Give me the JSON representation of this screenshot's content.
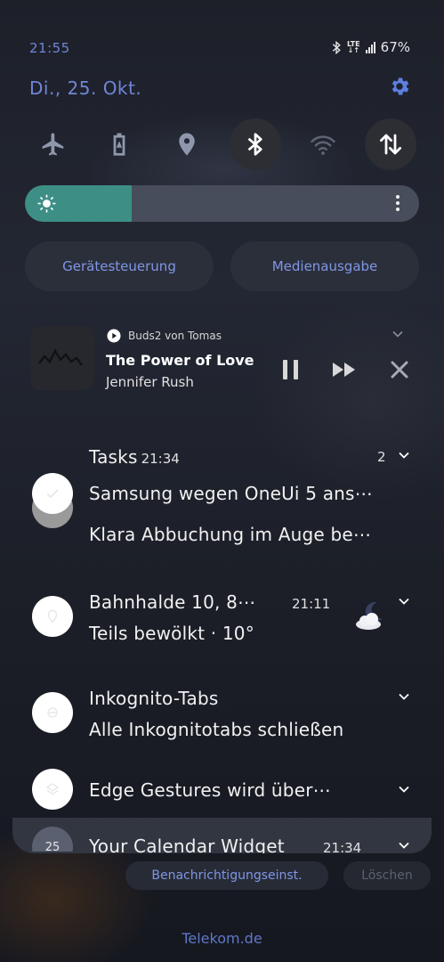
{
  "status_bar": {
    "time": "21:55",
    "network_type": "LTE",
    "battery": "67%",
    "icons": [
      "bluetooth-icon",
      "lte-icon",
      "signal-icon"
    ]
  },
  "header": {
    "date": "Di., 25. Okt.",
    "settings_icon": "gear-icon"
  },
  "quick_settings": {
    "toggles": [
      {
        "name": "airplane-mode",
        "icon": "airplane-icon",
        "active": false
      },
      {
        "name": "power-saving",
        "icon": "battery-saver-icon",
        "active": false
      },
      {
        "name": "location",
        "icon": "location-pin-icon",
        "active": false
      },
      {
        "name": "bluetooth",
        "icon": "bluetooth-icon",
        "active": true
      },
      {
        "name": "wifi",
        "icon": "wifi-icon",
        "active": false
      },
      {
        "name": "mobile-data",
        "icon": "data-arrows-icon",
        "active": true
      }
    ],
    "brightness_level": 0.27,
    "buttons": {
      "device_control": "Gerätesteuerung",
      "media_output": "Medienausgabe"
    }
  },
  "media": {
    "source": "Buds2 von Tomas",
    "title": "The Power of Love",
    "artist": "Jennifer Rush",
    "controls": [
      "pause-icon",
      "fast-forward-icon",
      "close-icon"
    ]
  },
  "notifications": {
    "tasks": {
      "app": "Tasks",
      "time": "21:34",
      "count": "2",
      "line1": "Samsung wegen OneUi 5 ans⋯",
      "line2": "Klara Abbuchung im Auge be⋯"
    },
    "weather": {
      "title": "Bahnhalde 10, 8⋯",
      "time": "21:11",
      "text": "Teils bewölkt · 10°",
      "icon": "moon-cloud-icon"
    },
    "incognito": {
      "title": "Inkognito-Tabs",
      "text": "Alle Inkognitotabs schließen"
    },
    "edge": {
      "title": "Edge Gestures wird über⋯"
    },
    "calendar": {
      "day": "25",
      "title": "Your Calendar Widget",
      "time": "21:34"
    }
  },
  "footer": {
    "notification_settings": "Benachrichtigungseinst.",
    "clear": "Löschen",
    "carrier": "Telekom.de"
  },
  "colors": {
    "accent": "#6f86d6",
    "brightness_fill": "#3d8f86",
    "panel": "#2b2f3a"
  }
}
